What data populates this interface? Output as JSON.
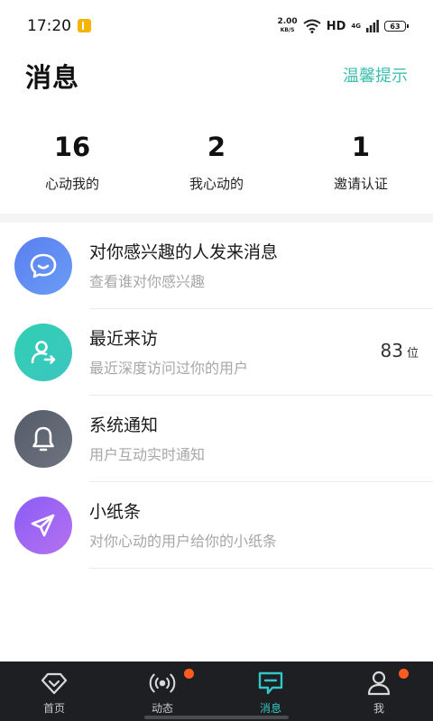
{
  "status_bar": {
    "time": "17:20",
    "net_speed": "2.00",
    "net_speed_unit": "KB/S",
    "hd": "HD",
    "signal": "4G",
    "battery": "63"
  },
  "header": {
    "title": "消息",
    "tips_label": "温馨提示"
  },
  "stats": [
    {
      "value": "16",
      "label": "心动我的"
    },
    {
      "value": "2",
      "label": "我心动的"
    },
    {
      "value": "1",
      "label": "邀请认证"
    }
  ],
  "messages": [
    {
      "title": "对你感兴趣的人发来消息",
      "subtitle": "查看谁对你感兴趣",
      "icon": "chat-smile-icon",
      "color": "#5a7ff0"
    },
    {
      "title": "最近来访",
      "subtitle": "最近深度访问过你的用户",
      "icon": "user-visit-icon",
      "color": "#2fcfb3",
      "count": "83",
      "count_unit": "位"
    },
    {
      "title": "系统通知",
      "subtitle": "用户互动实时通知",
      "icon": "bell-icon",
      "color": "#5c6370"
    },
    {
      "title": "小纸条",
      "subtitle": "对你心动的用户给你的小纸条",
      "icon": "paper-plane-icon",
      "color": "#9b63f3"
    }
  ],
  "bottom_nav": [
    {
      "label": "首页",
      "icon": "diamond-icon",
      "active": false,
      "dot": false
    },
    {
      "label": "动态",
      "icon": "broadcast-icon",
      "active": false,
      "dot": true
    },
    {
      "label": "消息",
      "icon": "message-icon",
      "active": true,
      "dot": false
    },
    {
      "label": "我",
      "icon": "profile-icon",
      "active": false,
      "dot": true
    }
  ],
  "colors": {
    "accent": "#3ec0b0",
    "nav_bg": "#1d1f22",
    "badge_dot": "#ff5a1f"
  }
}
